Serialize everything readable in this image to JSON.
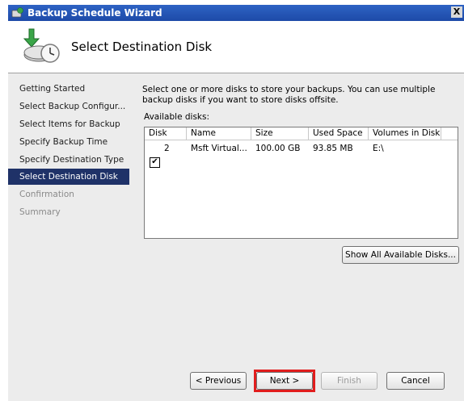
{
  "window": {
    "title": "Backup Schedule Wizard",
    "close_glyph": "X"
  },
  "header": {
    "title": "Select Destination Disk",
    "icon": "backup-disk-clock-icon"
  },
  "nav": {
    "items": [
      {
        "label": "Getting Started",
        "state": "normal"
      },
      {
        "label": "Select Backup Configur...",
        "state": "normal"
      },
      {
        "label": "Select Items for Backup",
        "state": "normal"
      },
      {
        "label": "Specify Backup Time",
        "state": "normal"
      },
      {
        "label": "Specify Destination Type",
        "state": "normal"
      },
      {
        "label": "Select Destination Disk",
        "state": "active"
      },
      {
        "label": "Confirmation",
        "state": "disabled"
      },
      {
        "label": "Summary",
        "state": "disabled"
      }
    ]
  },
  "main": {
    "description": "Select one or more disks to store your backups. You can use multiple backup disks if you want to store disks offsite.",
    "available_label": "Available disks:",
    "columns": [
      "Disk",
      "Name",
      "Size",
      "Used Space",
      "Volumes in Disk"
    ],
    "rows": [
      {
        "checked": true,
        "check_glyph": "✔",
        "disk": "2",
        "name": "Msft Virtual...",
        "size": "100.00 GB",
        "used": "93.85 MB",
        "volumes": "E:\\"
      }
    ],
    "show_all_label": "Show All Available Disks..."
  },
  "footer": {
    "previous": "< Previous",
    "next": "Next >",
    "finish": "Finish",
    "cancel": "Cancel"
  },
  "colors": {
    "titlebar": "#1d4aa8",
    "nav_active": "#1f3268",
    "highlight": "#e11d1d"
  }
}
